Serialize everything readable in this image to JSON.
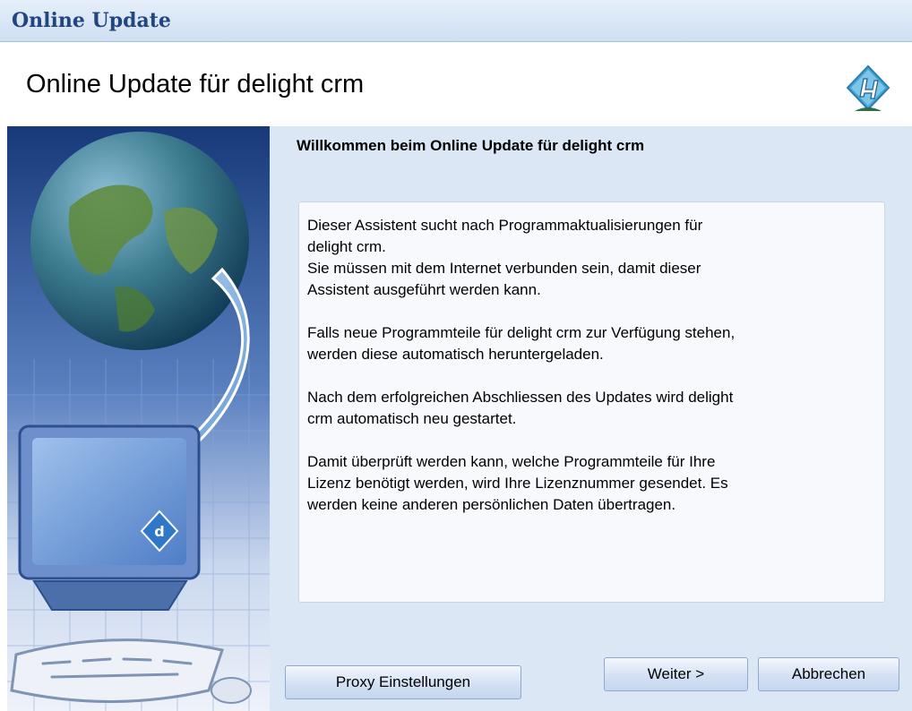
{
  "window": {
    "title": "Online Update"
  },
  "header": {
    "heading": "Online Update für delight crm",
    "logo_icon": "delight-logo-icon"
  },
  "main": {
    "welcome": "Willkommen beim Online Update für delight crm",
    "paragraphs": [
      "Dieser Assistent sucht nach Programmaktualisierungen für\ndelight crm.\nSie müssen mit dem Internet verbunden sein, damit dieser\nAssistent ausgeführt werden kann.",
      "Falls neue Programmteile für delight crm zur Verfügung stehen,\nwerden diese automatisch heruntergeladen.",
      "Nach dem erfolgreichen Abschliessen des Updates wird delight\ncrm automatisch neu gestartet.",
      "Damit überprüft werden kann, welche Programmteile für Ihre\nLizenz benötigt werden, wird Ihre Lizenznummer gesendet. Es\nwerden keine anderen persönlichen Daten übertragen."
    ]
  },
  "buttons": {
    "proxy": "Proxy Einstellungen",
    "next": "Weiter >",
    "cancel": "Abbrechen"
  },
  "sidebar": {
    "illustration": "globe-to-computer-update-illustration",
    "badge_letter": "d"
  },
  "colors": {
    "title_text": "#22477f",
    "content_bg": "#dce7f6",
    "sidebar_bg": "#1f4a94"
  }
}
